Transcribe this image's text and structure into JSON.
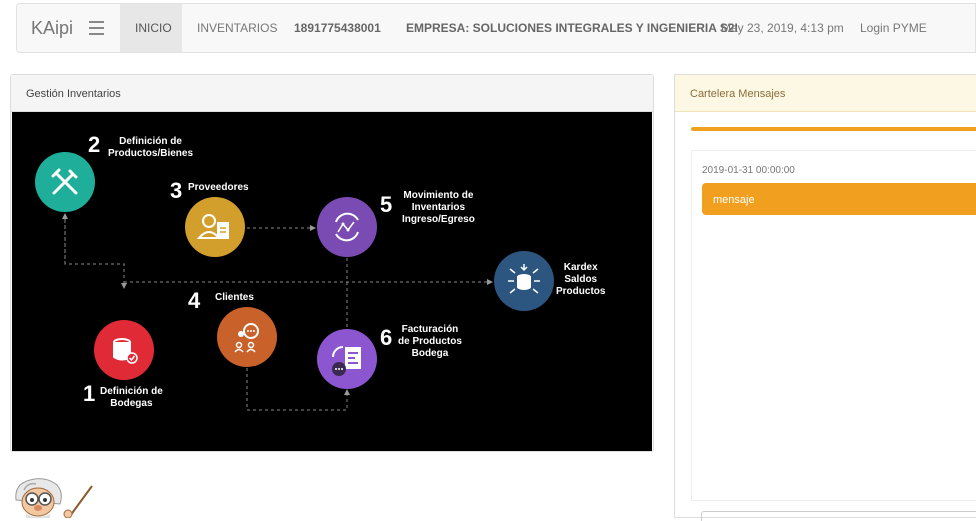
{
  "navbar": {
    "brand": "KAipi",
    "items": [
      {
        "label": "INICIO"
      },
      {
        "label": "INVENTARIOS"
      },
      {
        "label": "1891775438001"
      },
      {
        "label": "EMPRESA: SOLUCIONES INTEGRALES Y INGENIERIA S2I"
      },
      {
        "label": "May 23, 2019, 4:13 pm"
      },
      {
        "label": "Login PYME"
      }
    ]
  },
  "gestion": {
    "title": "Gestión Inventarios",
    "steps": [
      {
        "num": "1",
        "label": "Definición de\nBodegas",
        "color": "#e02b36",
        "icon": "database-icon"
      },
      {
        "num": "2",
        "label": "Definición de\nProductos/Bienes",
        "color": "#1fae99",
        "icon": "tools-icon"
      },
      {
        "num": "3",
        "label": "Proveedores",
        "color": "#d39f2c",
        "icon": "supplier-icon"
      },
      {
        "num": "4",
        "label": "Clientes",
        "color": "#c8612a",
        "icon": "clients-icon"
      },
      {
        "num": "5",
        "label": "Movimiento de\nInventarios\nIngreso/Egreso",
        "color": "#7a4cb3",
        "icon": "movement-icon"
      },
      {
        "num": "6",
        "label": "Facturación\nde Productos\nBodega",
        "color": "#8c56d0",
        "icon": "invoice-icon"
      }
    ],
    "kardex": {
      "label": "Kardex\nSaldos\nProductos",
      "color": "#2c557f",
      "icon": "kardex-icon"
    }
  },
  "cartelera": {
    "title": "Cartelera Mensajes",
    "messages": [
      {
        "date": "2019-01-31 00:00:00",
        "text": "mensaje"
      }
    ]
  }
}
